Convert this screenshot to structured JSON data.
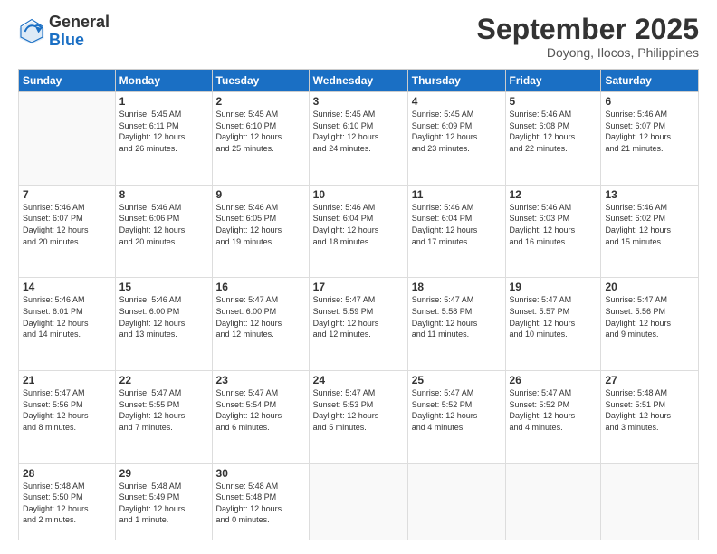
{
  "logo": {
    "general": "General",
    "blue": "Blue"
  },
  "header": {
    "month": "September 2025",
    "location": "Doyong, Ilocos, Philippines"
  },
  "weekdays": [
    "Sunday",
    "Monday",
    "Tuesday",
    "Wednesday",
    "Thursday",
    "Friday",
    "Saturday"
  ],
  "weeks": [
    [
      {
        "day": "",
        "info": ""
      },
      {
        "day": "1",
        "info": "Sunrise: 5:45 AM\nSunset: 6:11 PM\nDaylight: 12 hours\nand 26 minutes."
      },
      {
        "day": "2",
        "info": "Sunrise: 5:45 AM\nSunset: 6:10 PM\nDaylight: 12 hours\nand 25 minutes."
      },
      {
        "day": "3",
        "info": "Sunrise: 5:45 AM\nSunset: 6:10 PM\nDaylight: 12 hours\nand 24 minutes."
      },
      {
        "day": "4",
        "info": "Sunrise: 5:45 AM\nSunset: 6:09 PM\nDaylight: 12 hours\nand 23 minutes."
      },
      {
        "day": "5",
        "info": "Sunrise: 5:46 AM\nSunset: 6:08 PM\nDaylight: 12 hours\nand 22 minutes."
      },
      {
        "day": "6",
        "info": "Sunrise: 5:46 AM\nSunset: 6:07 PM\nDaylight: 12 hours\nand 21 minutes."
      }
    ],
    [
      {
        "day": "7",
        "info": "Sunrise: 5:46 AM\nSunset: 6:07 PM\nDaylight: 12 hours\nand 20 minutes."
      },
      {
        "day": "8",
        "info": "Sunrise: 5:46 AM\nSunset: 6:06 PM\nDaylight: 12 hours\nand 20 minutes."
      },
      {
        "day": "9",
        "info": "Sunrise: 5:46 AM\nSunset: 6:05 PM\nDaylight: 12 hours\nand 19 minutes."
      },
      {
        "day": "10",
        "info": "Sunrise: 5:46 AM\nSunset: 6:04 PM\nDaylight: 12 hours\nand 18 minutes."
      },
      {
        "day": "11",
        "info": "Sunrise: 5:46 AM\nSunset: 6:04 PM\nDaylight: 12 hours\nand 17 minutes."
      },
      {
        "day": "12",
        "info": "Sunrise: 5:46 AM\nSunset: 6:03 PM\nDaylight: 12 hours\nand 16 minutes."
      },
      {
        "day": "13",
        "info": "Sunrise: 5:46 AM\nSunset: 6:02 PM\nDaylight: 12 hours\nand 15 minutes."
      }
    ],
    [
      {
        "day": "14",
        "info": "Sunrise: 5:46 AM\nSunset: 6:01 PM\nDaylight: 12 hours\nand 14 minutes."
      },
      {
        "day": "15",
        "info": "Sunrise: 5:46 AM\nSunset: 6:00 PM\nDaylight: 12 hours\nand 13 minutes."
      },
      {
        "day": "16",
        "info": "Sunrise: 5:47 AM\nSunset: 6:00 PM\nDaylight: 12 hours\nand 12 minutes."
      },
      {
        "day": "17",
        "info": "Sunrise: 5:47 AM\nSunset: 5:59 PM\nDaylight: 12 hours\nand 12 minutes."
      },
      {
        "day": "18",
        "info": "Sunrise: 5:47 AM\nSunset: 5:58 PM\nDaylight: 12 hours\nand 11 minutes."
      },
      {
        "day": "19",
        "info": "Sunrise: 5:47 AM\nSunset: 5:57 PM\nDaylight: 12 hours\nand 10 minutes."
      },
      {
        "day": "20",
        "info": "Sunrise: 5:47 AM\nSunset: 5:56 PM\nDaylight: 12 hours\nand 9 minutes."
      }
    ],
    [
      {
        "day": "21",
        "info": "Sunrise: 5:47 AM\nSunset: 5:56 PM\nDaylight: 12 hours\nand 8 minutes."
      },
      {
        "day": "22",
        "info": "Sunrise: 5:47 AM\nSunset: 5:55 PM\nDaylight: 12 hours\nand 7 minutes."
      },
      {
        "day": "23",
        "info": "Sunrise: 5:47 AM\nSunset: 5:54 PM\nDaylight: 12 hours\nand 6 minutes."
      },
      {
        "day": "24",
        "info": "Sunrise: 5:47 AM\nSunset: 5:53 PM\nDaylight: 12 hours\nand 5 minutes."
      },
      {
        "day": "25",
        "info": "Sunrise: 5:47 AM\nSunset: 5:52 PM\nDaylight: 12 hours\nand 4 minutes."
      },
      {
        "day": "26",
        "info": "Sunrise: 5:47 AM\nSunset: 5:52 PM\nDaylight: 12 hours\nand 4 minutes."
      },
      {
        "day": "27",
        "info": "Sunrise: 5:48 AM\nSunset: 5:51 PM\nDaylight: 12 hours\nand 3 minutes."
      }
    ],
    [
      {
        "day": "28",
        "info": "Sunrise: 5:48 AM\nSunset: 5:50 PM\nDaylight: 12 hours\nand 2 minutes."
      },
      {
        "day": "29",
        "info": "Sunrise: 5:48 AM\nSunset: 5:49 PM\nDaylight: 12 hours\nand 1 minute."
      },
      {
        "day": "30",
        "info": "Sunrise: 5:48 AM\nSunset: 5:48 PM\nDaylight: 12 hours\nand 0 minutes."
      },
      {
        "day": "",
        "info": ""
      },
      {
        "day": "",
        "info": ""
      },
      {
        "day": "",
        "info": ""
      },
      {
        "day": "",
        "info": ""
      }
    ]
  ]
}
